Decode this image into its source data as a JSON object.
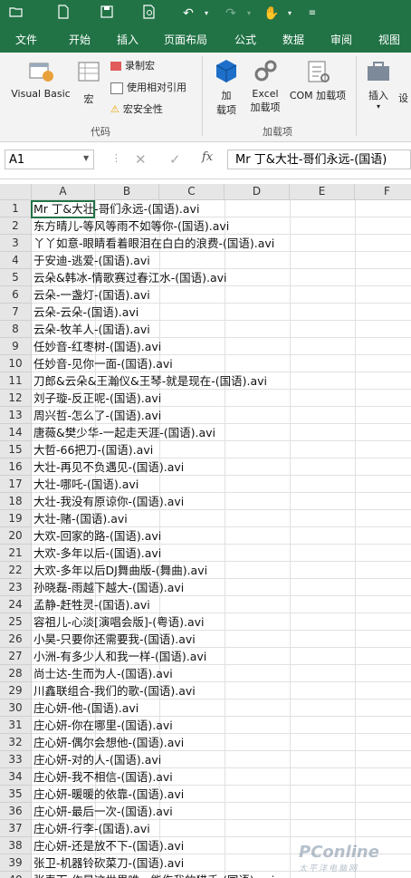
{
  "quick_access": {
    "icons": [
      "folder-open-icon",
      "new-document-icon",
      "save-icon",
      "print-preview-icon",
      "undo-icon",
      "undo-dropdown-icon",
      "redo-icon",
      "redo-dropdown-icon",
      "touch-mode-icon",
      "touch-dropdown-icon",
      "customize-icon"
    ]
  },
  "tabs": [
    "文件",
    "开始",
    "插入",
    "页面布局",
    "公式",
    "数据",
    "审阅",
    "视图"
  ],
  "ribbon": {
    "code_group": {
      "visual_basic": "Visual Basic",
      "macros": "宏",
      "record_macro": "录制宏",
      "relative_ref": "使用相对引用",
      "macro_security": "宏安全性",
      "label": "代码"
    },
    "addins_group": {
      "addins": "加",
      "addins2": "载项",
      "excel_addins": "Excel",
      "excel_addins2": "加载项",
      "com_addins": "COM 加载项",
      "label": "加载项"
    },
    "insert": "插入",
    "design": "设"
  },
  "formula_bar": {
    "name_box": "A1",
    "formula": "Mr 丁&大壮-哥们永远-(国语)"
  },
  "columns": [
    "A",
    "B",
    "C",
    "D",
    "E",
    "F"
  ],
  "rows": [
    {
      "num": "1",
      "text": "Mr 丁&大壮-哥们永远-(国语).avi"
    },
    {
      "num": "2",
      "text": "东方晴儿-等风等雨不如等你-(国语).avi"
    },
    {
      "num": "3",
      "text": "丫丫如意-眼睛看着眼泪在白白的浪费-(国语).avi"
    },
    {
      "num": "4",
      "text": "于安迪-逃爱-(国语).avi"
    },
    {
      "num": "5",
      "text": "云朵&韩冰-情歌赛过春江水-(国语).avi"
    },
    {
      "num": "6",
      "text": "云朵-一盏灯-(国语).avi"
    },
    {
      "num": "7",
      "text": "云朵-云朵-(国语).avi"
    },
    {
      "num": "8",
      "text": "云朵-牧羊人-(国语).avi"
    },
    {
      "num": "9",
      "text": "任妙音-红枣树-(国语).avi"
    },
    {
      "num": "10",
      "text": "任妙音-见你一面-(国语).avi"
    },
    {
      "num": "11",
      "text": "刀郎&云朵&王瀚仪&王琴-就是现在-(国语).avi"
    },
    {
      "num": "12",
      "text": "刘子璇-反正呢-(国语).avi"
    },
    {
      "num": "13",
      "text": "周兴哲-怎么了-(国语).avi"
    },
    {
      "num": "14",
      "text": "唐薇&樊少华-一起走天涯-(国语).avi"
    },
    {
      "num": "15",
      "text": "大哲-66把刀-(国语).avi"
    },
    {
      "num": "16",
      "text": "大壮-再见不负遇见-(国语).avi"
    },
    {
      "num": "17",
      "text": "大壮-哪吒-(国语).avi"
    },
    {
      "num": "18",
      "text": "大壮-我没有原谅你-(国语).avi"
    },
    {
      "num": "19",
      "text": "大壮-赌-(国语).avi"
    },
    {
      "num": "20",
      "text": "大欢-回家的路-(国语).avi"
    },
    {
      "num": "21",
      "text": "大欢-多年以后-(国语).avi"
    },
    {
      "num": "22",
      "text": "大欢-多年以后DJ舞曲版-(舞曲).avi"
    },
    {
      "num": "23",
      "text": "孙晓磊-雨越下越大-(国语).avi"
    },
    {
      "num": "24",
      "text": "孟静-赶牲灵-(国语).avi"
    },
    {
      "num": "25",
      "text": "容祖儿-心淡[演唱会版]-(粤语).avi"
    },
    {
      "num": "26",
      "text": "小昊-只要你还需要我-(国语).avi"
    },
    {
      "num": "27",
      "text": "小洲-有多少人和我一样-(国语).avi"
    },
    {
      "num": "28",
      "text": "尚士达-生而为人-(国语).avi"
    },
    {
      "num": "29",
      "text": "川鑫联组合-我们的歌-(国语).avi"
    },
    {
      "num": "30",
      "text": "庄心妍-他-(国语).avi"
    },
    {
      "num": "31",
      "text": "庄心妍-你在哪里-(国语).avi"
    },
    {
      "num": "32",
      "text": "庄心妍-偶尔会想他-(国语).avi"
    },
    {
      "num": "33",
      "text": "庄心妍-对的人-(国语).avi"
    },
    {
      "num": "34",
      "text": "庄心妍-我不相信-(国语).avi"
    },
    {
      "num": "35",
      "text": "庄心妍-暖暖的依靠-(国语).avi"
    },
    {
      "num": "36",
      "text": "庄心妍-最后一次-(国语).avi"
    },
    {
      "num": "37",
      "text": "庄心妍-行李-(国语).avi"
    },
    {
      "num": "38",
      "text": "庄心妍-还是放不下-(国语).avi"
    },
    {
      "num": "39",
      "text": "张卫-机器铃砍菜刀-(国语).avi"
    },
    {
      "num": "40",
      "text": "张春而-作是这世界唯一能伤我的猎手-(国语).avi"
    }
  ],
  "watermark": {
    "main": "PConline",
    "sub": "太平洋电脑网"
  }
}
